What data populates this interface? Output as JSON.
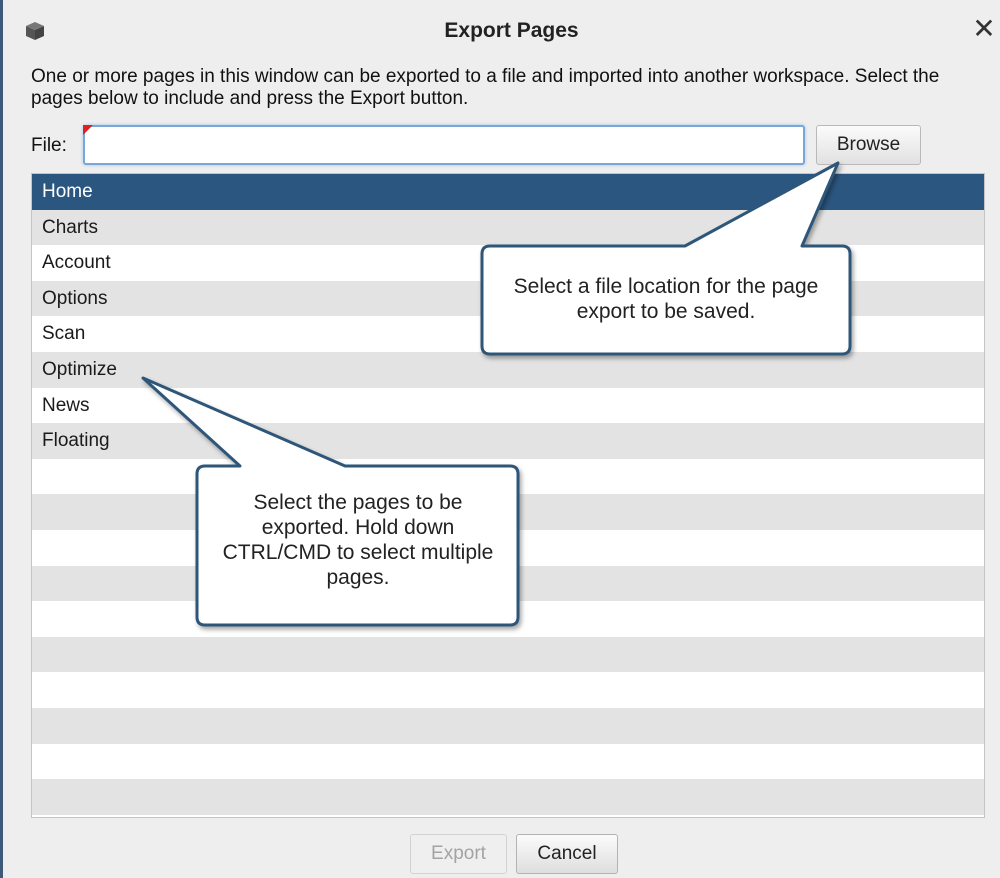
{
  "dialog": {
    "title": "Export Pages",
    "close_glyph": "✕",
    "description": "One or more pages in this window can be exported to a file and imported into another workspace.  Select the pages below to include and press the Export button.",
    "file_label": "File:",
    "file_value": "",
    "browse_label": "Browse",
    "export_label": "Export",
    "cancel_label": "Cancel"
  },
  "icons": {
    "app": "cube-icon",
    "close": "close-icon"
  },
  "pages": [
    {
      "label": "Home",
      "selected": true
    },
    {
      "label": "Charts",
      "selected": false
    },
    {
      "label": "Account",
      "selected": false
    },
    {
      "label": "Options",
      "selected": false
    },
    {
      "label": "Scan",
      "selected": false
    },
    {
      "label": "Optimize",
      "selected": false
    },
    {
      "label": "News",
      "selected": false
    },
    {
      "label": "Floating",
      "selected": false
    },
    {
      "label": "",
      "selected": false
    },
    {
      "label": "",
      "selected": false
    },
    {
      "label": "",
      "selected": false
    },
    {
      "label": "",
      "selected": false
    },
    {
      "label": "",
      "selected": false
    },
    {
      "label": "",
      "selected": false
    },
    {
      "label": "",
      "selected": false
    },
    {
      "label": "",
      "selected": false
    },
    {
      "label": "",
      "selected": false
    },
    {
      "label": "",
      "selected": false
    }
  ],
  "callouts": {
    "file": "Select a file location for the page export to be saved.",
    "pages": "Select the pages to be exported. Hold down CTRL/CMD to select multiple pages."
  },
  "colors": {
    "selection": "#2b5680",
    "row_alt": "#e3e3e3",
    "callout_border": "#2f5679",
    "window_border": "#3f5a78"
  }
}
